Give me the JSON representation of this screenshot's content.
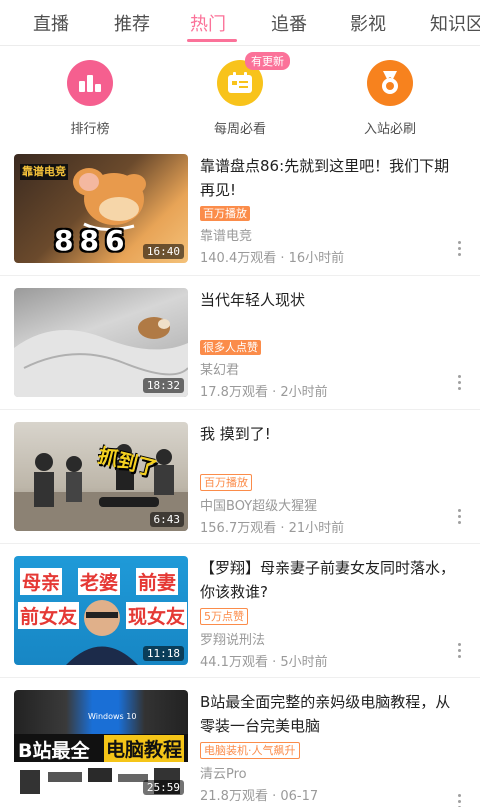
{
  "tabs": [
    {
      "label": "直播"
    },
    {
      "label": "推荐"
    },
    {
      "label": "热门"
    },
    {
      "label": "追番"
    },
    {
      "label": "影视"
    },
    {
      "label": "知识区"
    }
  ],
  "active_tab": "热门",
  "quick_entries": [
    {
      "label": "排行榜",
      "icon": "bar-chart-icon",
      "color": "#f55f8f",
      "badge": ""
    },
    {
      "label": "每周必看",
      "icon": "calendar-icon",
      "color": "#f8c31b",
      "badge": "有更新"
    },
    {
      "label": "入站必刷",
      "icon": "medal-icon",
      "color": "#f7821e",
      "badge": ""
    }
  ],
  "videos": [
    {
      "title": "靠谱盘点86:先就到这里吧！我们下期再见!",
      "tag": "百万播放",
      "tag_style": "filled",
      "author": "靠谱电竞",
      "stats": "140.4万观看 · 16小时前",
      "duration": "16:40",
      "thumb_text": "886",
      "thumb_logo": "靠谱电竞"
    },
    {
      "title": "当代年轻人现状",
      "tag": "很多人点赞",
      "tag_style": "filled",
      "author": "某幻君",
      "stats": "17.8万观看 · 2小时前",
      "duration": "18:32"
    },
    {
      "title": "我 摸到了!",
      "tag": "百万播放",
      "tag_style": "outline",
      "author": "中国BOY超级大猩猩",
      "stats": "156.7万观看 · 21小时前",
      "duration": "6:43",
      "thumb_text": "抓到了"
    },
    {
      "title": "【罗翔】母亲妻子前妻女友同时落水，你该救谁?",
      "tag": "5万点赞",
      "tag_style": "outline",
      "author": "罗翔说刑法",
      "stats": "44.1万观看 · 5小时前",
      "duration": "11:18",
      "thumb_words": [
        "母亲",
        "老婆",
        "前妻",
        "前女友",
        "现女友"
      ]
    },
    {
      "title": "B站最全面完整的亲妈级电脑教程，从零装一台完美电脑",
      "tag": "电脑装机·人气飙升",
      "tag_style": "outline",
      "author": "清云Pro",
      "stats": "21.8万观看 · 06-17",
      "duration": "25:59",
      "thumb_text_a": "B站最全",
      "thumb_text_b": "电脑教程",
      "thumb_os": "Windows 10"
    }
  ]
}
